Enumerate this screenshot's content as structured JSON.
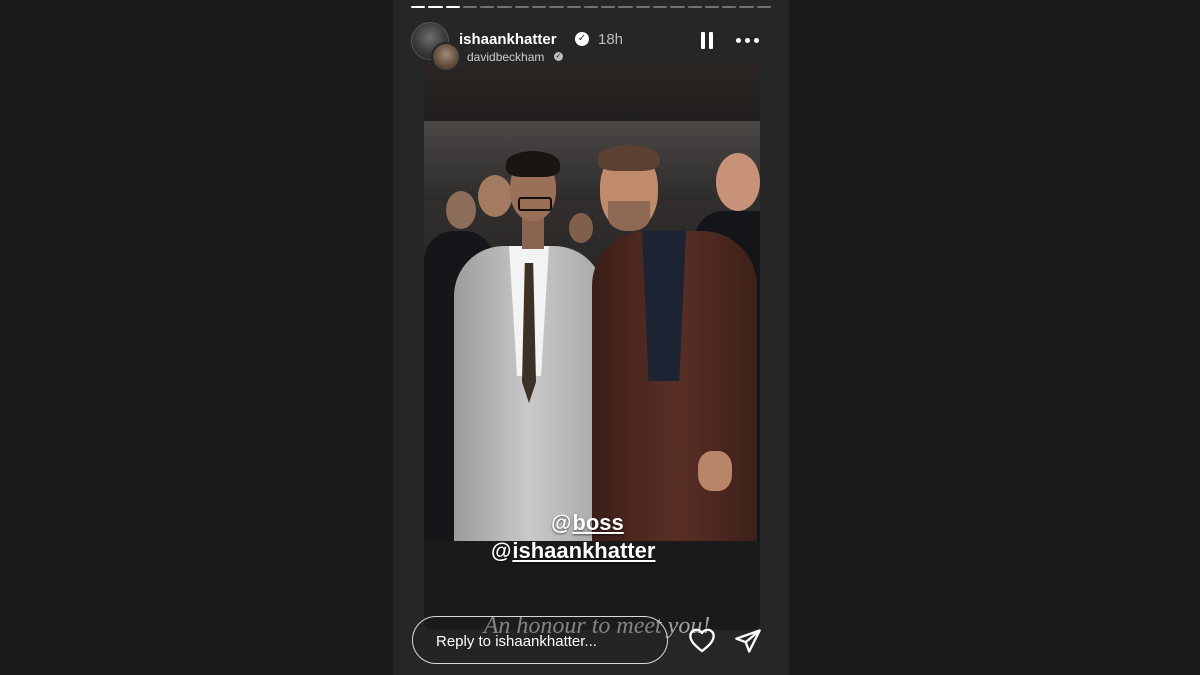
{
  "story": {
    "progress": {
      "total_segments": 21,
      "completed_segments": 3
    },
    "header": {
      "username": "ishaankhatter",
      "verified": true,
      "timestamp": "18h",
      "collab_username": "davidbeckham",
      "collab_verified": true
    },
    "tags": {
      "boss": "boss",
      "ishaan": "ishaankhatter"
    },
    "caption": "An honour to meet you!",
    "reply": {
      "placeholder": "Reply to ishaankhatter..."
    },
    "icons": {
      "pause": "pause-icon",
      "more": "more-options-icon",
      "heart": "heart-icon",
      "send": "send-icon",
      "verified": "verified-badge-icon",
      "threads": "threads-icon"
    }
  }
}
